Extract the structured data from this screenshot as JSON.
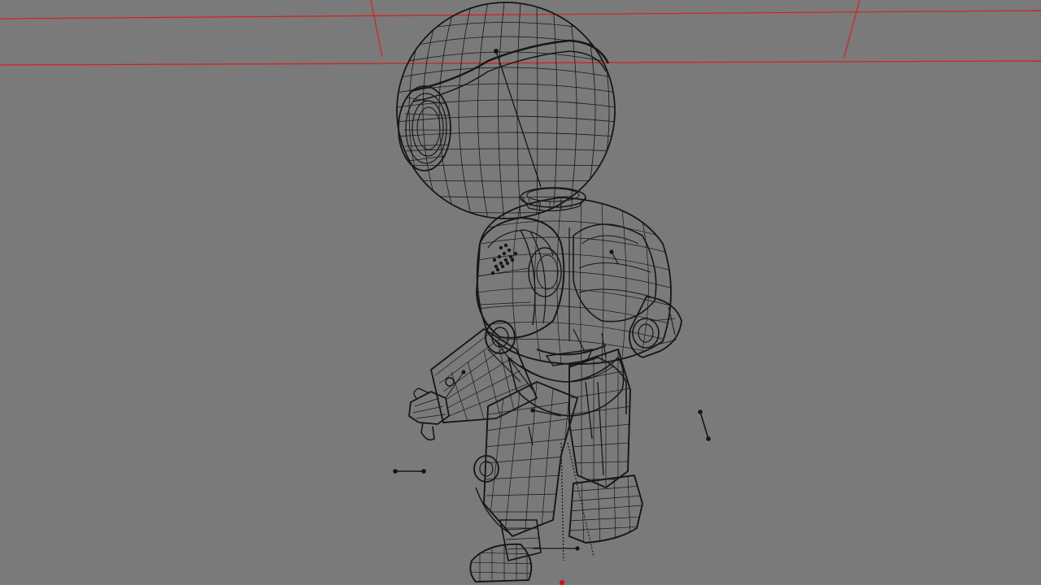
{
  "viewport": {
    "view_mode": "wireframe",
    "colors": {
      "background": "#7a7a7a",
      "wire": "#161616",
      "grid": "#d81e1e",
      "origin_marker": "#d01010"
    }
  },
  "scene": {
    "subject": "robot-character-mesh",
    "parts": [
      "head",
      "visor",
      "neck-ring",
      "torso",
      "shoulder-pad",
      "left-arm",
      "right-arm",
      "left-hand",
      "pelvis",
      "left-leg",
      "right-leg",
      "left-boot",
      "right-boot"
    ],
    "helpers": [
      "bone-handle",
      "bone-handle",
      "bone-handle",
      "origin-marker"
    ]
  }
}
